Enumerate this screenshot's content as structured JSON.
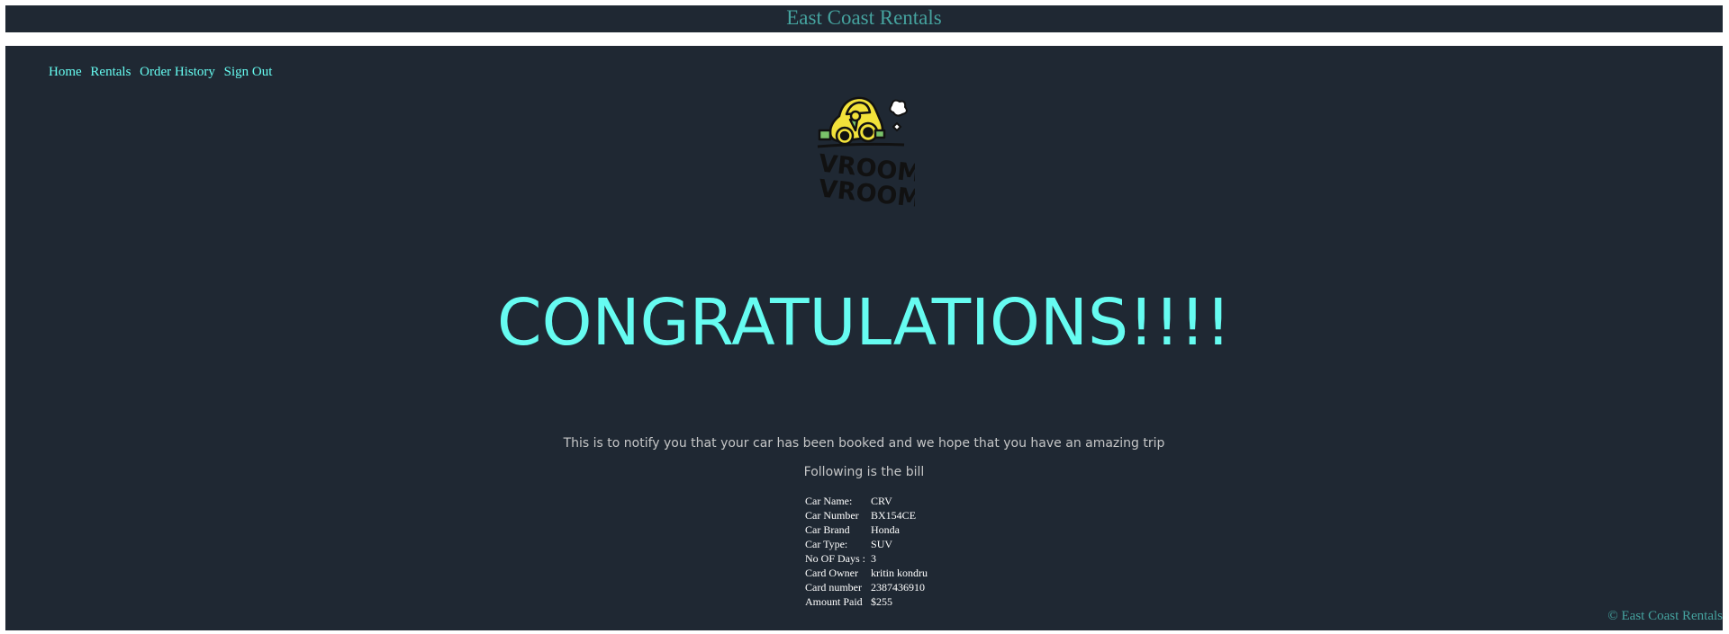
{
  "header": {
    "title": "East Coast Rentals"
  },
  "nav": {
    "items": [
      "Home",
      "Rentals",
      "Order History",
      "Sign Out"
    ]
  },
  "logo": {
    "text_line1": "VROOM!",
    "text_line2": "VROOM!"
  },
  "main": {
    "heading": "CONGRATULATIONS!!!!",
    "notify_text": "This is to notify you that your car has been booked and we hope that you have an amazing trip",
    "bill_heading": "Following is the bill"
  },
  "bill": {
    "rows": [
      {
        "label": "Car Name:",
        "value": "CRV"
      },
      {
        "label": "Car Number",
        "value": "BX154CE"
      },
      {
        "label": "Car Brand",
        "value": "Honda"
      },
      {
        "label": "Car Type:",
        "value": "SUV"
      },
      {
        "label": "No OF Days :",
        "value": "3"
      },
      {
        "label": "Card Owner",
        "value": "kritin kondru"
      },
      {
        "label": "Card number",
        "value": "2387436910"
      },
      {
        "label": "Amount Paid",
        "value": "$255"
      }
    ]
  },
  "footer": {
    "text": "© East Coast Rentals"
  },
  "colors": {
    "background": "#1f2833",
    "accent": "#66fcf1",
    "title": "#45a29e",
    "body_text": "#c5c6c7"
  }
}
